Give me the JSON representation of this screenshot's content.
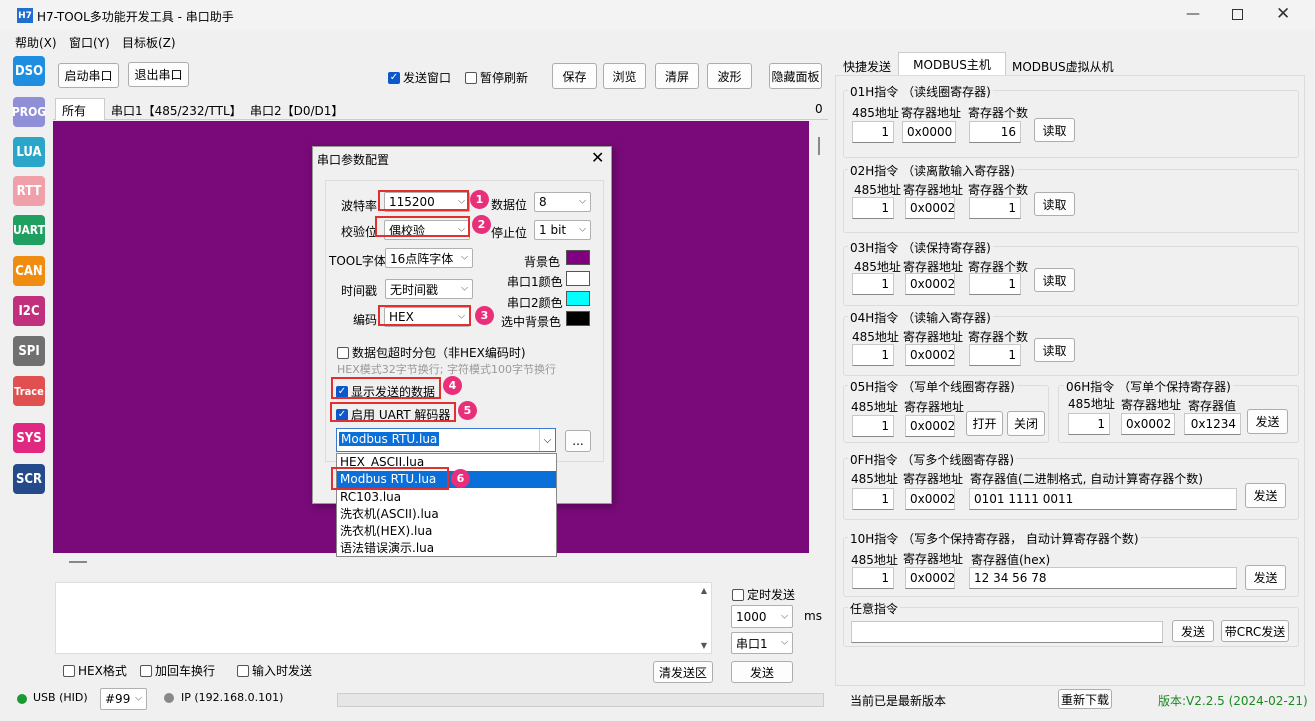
{
  "window": {
    "app_icon": "H7",
    "title": "H7-TOOL多功能开发工具 - 串口助手"
  },
  "menu": [
    "帮助(X)",
    "窗口(Y)",
    "目标板(Z)"
  ],
  "sidebar": [
    {
      "label": "DSO",
      "color": "#1e8fe0"
    },
    {
      "label": "PROG",
      "color": "#8f8fd8"
    },
    {
      "label": "LUA",
      "color": "#2aa7c8"
    },
    {
      "label": "RTT",
      "color": "#f0a0a8"
    },
    {
      "label": "UART",
      "color": "#20a060"
    },
    {
      "label": "CAN",
      "color": "#f08c10"
    },
    {
      "label": "I2C",
      "color": "#c0307c"
    },
    {
      "label": "SPI",
      "color": "#707070"
    },
    {
      "label": "Trace",
      "color": "#e05050"
    },
    {
      "label": "SYS",
      "color": "#e02880"
    },
    {
      "label": "SCR",
      "color": "#254a8c"
    }
  ],
  "toolbar": {
    "open_port": "启动串口",
    "close_port": "退出串口",
    "send_window": "发送窗口",
    "pause_refresh": "暂停刷新",
    "save": "保存",
    "browse": "浏览",
    "clear": "清屏",
    "wave": "波形",
    "hide_panel": "隐藏面板"
  },
  "recv_tabs": [
    "所有",
    "串口1【485/232/TTL】",
    "串口2【D0/D1】"
  ],
  "recv_count": "0",
  "terminal_bg": "#7a0a7a",
  "dialog": {
    "title": "串口参数配置",
    "baud_label": "波特率",
    "baud_value": "115200",
    "databits_label": "数据位",
    "databits_value": "8",
    "parity_label": "校验位",
    "parity_value": "偶校验",
    "stopbits_label": "停止位",
    "stopbits_value": "1 bit",
    "font_label": "TOOL字体",
    "font_value": "16点阵字体",
    "timestamp_label": "时间戳",
    "timestamp_value": "无时间戳",
    "encoding_label": "编码",
    "encoding_value": "HEX",
    "bg_color_label": "背景色",
    "port1_color_label": "串口1颜色",
    "port2_color_label": "串口2颜色",
    "sel_bg_label": "选中背景色",
    "swatches": {
      "bg": "#800080",
      "port1": "#ffffff",
      "port2": "#00ffff",
      "sel": "#000000"
    },
    "packet_timeout": "数据包超时分包（非HEX编码时)",
    "hint": "HEX模式32字节换行; 字符模式100字节换行",
    "show_sent": "显示发送的数据",
    "enable_decoder": "启用 UART 解码器",
    "decoder_value": "Modbus RTU.lua",
    "more": "...",
    "decoder_options": [
      "HEX_ASCII.lua",
      "Modbus RTU.lua",
      "RC103.lua",
      "洗衣机(ASCII).lua",
      "洗衣机(HEX).lua",
      "语法错误演示.lua"
    ],
    "badges": [
      "1",
      "2",
      "3",
      "4",
      "5",
      "6"
    ]
  },
  "send": {
    "timed_send": "定时发送",
    "interval": "1000",
    "unit": "ms",
    "port": "串口1",
    "hex_fmt": "HEX格式",
    "add_crlf": "加回车换行",
    "send_on_input": "输入时发送",
    "clear_send": "清发送区",
    "send": "发送"
  },
  "status": {
    "usb": "USB (HID)",
    "num": "#99",
    "ip": "IP (192.168.0.101)",
    "msg": "当前已是最新版本",
    "redownload": "重新下载",
    "version": "版本:V2.2.5 (2024-02-21)"
  },
  "right_tabs": [
    "快捷发送",
    "MODBUS主机",
    "MODBUS虚拟从机"
  ],
  "labels": {
    "addr485": "485地址",
    "reg_addr": "寄存器地址",
    "reg_count": "寄存器个数",
    "reg_value": "寄存器值",
    "read": "读取",
    "send": "发送",
    "open": "打开",
    "close": "关闭"
  },
  "modbus": {
    "g01": {
      "title": "01H指令 （读线圈寄存器)",
      "addr": "1",
      "reg": "0x0000",
      "count": "16"
    },
    "g02": {
      "title": "02H指令 （读离散输入寄存器)",
      "addr": "1",
      "reg": "0x0002",
      "count": "1"
    },
    "g03": {
      "title": "03H指令 （读保持寄存器)",
      "addr": "1",
      "reg": "0x0002",
      "count": "1"
    },
    "g04": {
      "title": "04H指令 （读输入寄存器)",
      "addr": "1",
      "reg": "0x0002",
      "count": "1"
    },
    "g05": {
      "title": "05H指令 （写单个线圈寄存器)",
      "addr": "1",
      "reg": "0x0002"
    },
    "g06": {
      "title": "06H指令 （写单个保持寄存器)",
      "addr": "1",
      "reg": "0x0002",
      "value": "0x1234"
    },
    "g0f": {
      "title": "0FH指令 （写多个线圈寄存器)",
      "value_label": "寄存器值(二进制格式, 自动计算寄存器个数)",
      "addr": "1",
      "reg": "0x0002",
      "value": "0101 1111 0011"
    },
    "g10": {
      "title": "10H指令 （写多个保持寄存器， 自动计算寄存器个数)",
      "value_label": "寄存器值(hex)",
      "addr": "1",
      "reg": "0x0002",
      "value": "12 34 56 78"
    },
    "any": {
      "title": "任意指令",
      "send": "发送",
      "crc_send": "带CRC发送"
    }
  }
}
